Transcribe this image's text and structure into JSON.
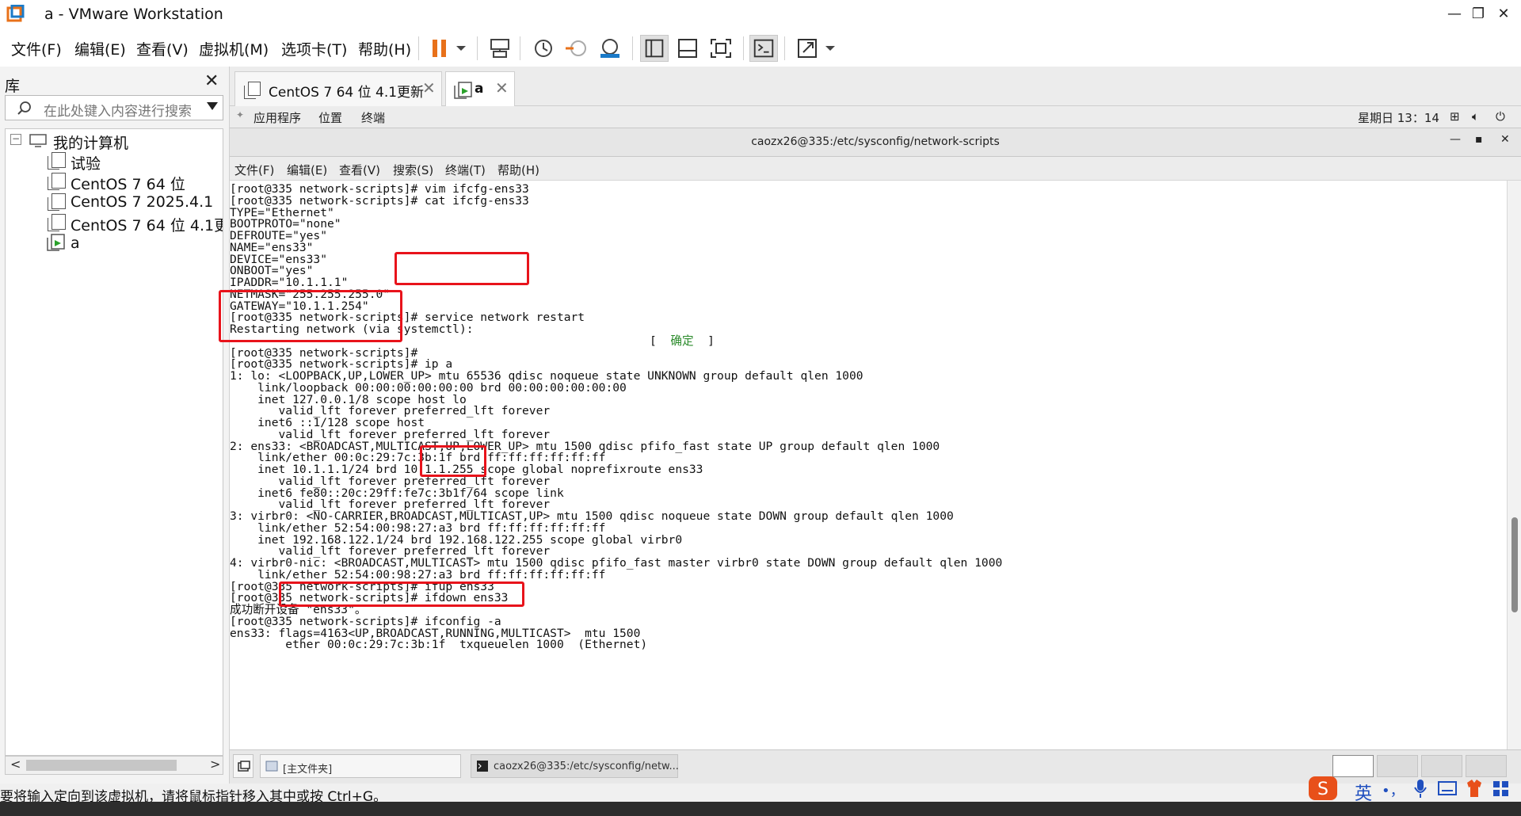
{
  "window": {
    "title": "a - VMware Workstation",
    "minimize": "—",
    "maximize": "❐",
    "close": "✕"
  },
  "menubar": {
    "items": [
      "文件(F)",
      "编辑(E)",
      "查看(V)",
      "虚拟机(M)",
      "选项卡(T)",
      "帮助(H)"
    ],
    "toolbar_icons": [
      "pause-icon",
      "dropdown-icon",
      "send-keys-icon",
      "snapshot-icon",
      "revert-snapshot-icon",
      "snapshot-manager-icon",
      "library-view-icon",
      "thumbnail-bar-icon",
      "fullscreen-icon",
      "console-view-icon",
      "stretch-icon",
      "dropdown-icon"
    ]
  },
  "library": {
    "title": "库",
    "close": "✕",
    "search_placeholder": "在此处键入内容进行搜索",
    "tree": {
      "root": "我的计算机",
      "items": [
        "试验",
        "CentOS 7 64 位",
        "CentOS 7 2025.4.1",
        "CentOS 7 64 位 4.1更新",
        "a"
      ]
    },
    "scroll_left": "<",
    "scroll_right": ">"
  },
  "tabs": [
    {
      "label": "CentOS 7 64 位 4.1更新",
      "close": "✕"
    },
    {
      "label": "a",
      "close": "✕"
    }
  ],
  "guest_topbar": {
    "apps": "应用程序",
    "places": "位置",
    "terminal": "终端",
    "clock": "星期日 13：14"
  },
  "terminal_window": {
    "title": "caozx26@335:/etc/sysconfig/network-scripts",
    "min": "—",
    "max": "▪",
    "close": "✕",
    "menu": [
      "文件(F)",
      "编辑(E)",
      "查看(V)",
      "搜索(S)",
      "终端(T)",
      "帮助(H)"
    ]
  },
  "terminal_lines": [
    "[root@335 network-scripts]# vim ifcfg-ens33",
    "[root@335 network-scripts]# cat ifcfg-ens33",
    "TYPE=\"Ethernet\"",
    "BOOTPROTO=\"none\"",
    "DEFROUTE=\"yes\"",
    "NAME=\"ens33\"",
    "DEVICE=\"ens33\"",
    "ONBOOT=\"yes\"",
    "IPADDR=\"10.1.1.1\"",
    "NETMASK=\"255.255.255.0\"",
    "GATEWAY=\"10.1.1.254\"",
    "[root@335 network-scripts]# service network restart",
    "Restarting network (via systemctl):",
    "__OK__",
    "[root@335 network-scripts]#",
    "[root@335 network-scripts]# ip a",
    "1: lo: <LOOPBACK,UP,LOWER_UP> mtu 65536 qdisc noqueue state UNKNOWN group default qlen 1000",
    "    link/loopback 00:00:00:00:00:00 brd 00:00:00:00:00:00",
    "    inet 127.0.0.1/8 scope host lo",
    "       valid_lft forever preferred_lft forever",
    "    inet6 ::1/128 scope host",
    "       valid_lft forever preferred_lft forever",
    "2: ens33: <BROADCAST,MULTICAST,UP,LOWER_UP> mtu 1500 qdisc pfifo_fast state UP group default qlen 1000",
    "    link/ether 00:0c:29:7c:3b:1f brd ff:ff:ff:ff:ff:ff",
    "    inet 10.1.1.1/24 brd 10.1.1.255 scope global noprefixroute ens33",
    "       valid_lft forever preferred_lft forever",
    "    inet6 fe80::20c:29ff:fe7c:3b1f/64 scope link",
    "       valid_lft forever preferred_lft forever",
    "3: virbr0: <NO-CARRIER,BROADCAST,MULTICAST,UP> mtu 1500 qdisc noqueue state DOWN group default qlen 1000",
    "    link/ether 52:54:00:98:27:a3 brd ff:ff:ff:ff:ff:ff",
    "    inet 192.168.122.1/24 brd 192.168.122.255 scope global virbr0",
    "       valid_lft forever preferred_lft forever",
    "4: virbr0-nic: <BROADCAST,MULTICAST> mtu 1500 qdisc pfifo_fast master virbr0 state DOWN group default qlen 1000",
    "    link/ether 52:54:00:98:27:a3 brd ff:ff:ff:ff:ff:ff",
    "[root@335 network-scripts]# ifup ens33",
    "[root@335 network-scripts]# ifdown ens33",
    "成功断开设备 \"ens33\"。",
    "[root@335 network-scripts]# ifconfig -a",
    "ens33: flags=4163<UP,BROADCAST,RUNNING,MULTICAST>  mtu 1500",
    "        ether 00:0c:29:7c:3b:1f  txqueuelen 1000  (Ethernet)"
  ],
  "ok_prefix": "[  ",
  "ok_text": "确定",
  "ok_suffix": "  ]",
  "taskbar": {
    "task1": "[主文件夹]",
    "task2": "caozx26@335:/etc/sysconfig/netw..."
  },
  "statusbar": {
    "message": "要将输入定向到该虚拟机，请将鼠标指针移入其中或按 Ctrl+G。"
  },
  "ime": {
    "lang": "英",
    "punct": "•，"
  },
  "colors": {
    "highlight_box": "#e8131b",
    "ok_green": "#2a8a2a",
    "pause_orange": "#e8711a"
  }
}
